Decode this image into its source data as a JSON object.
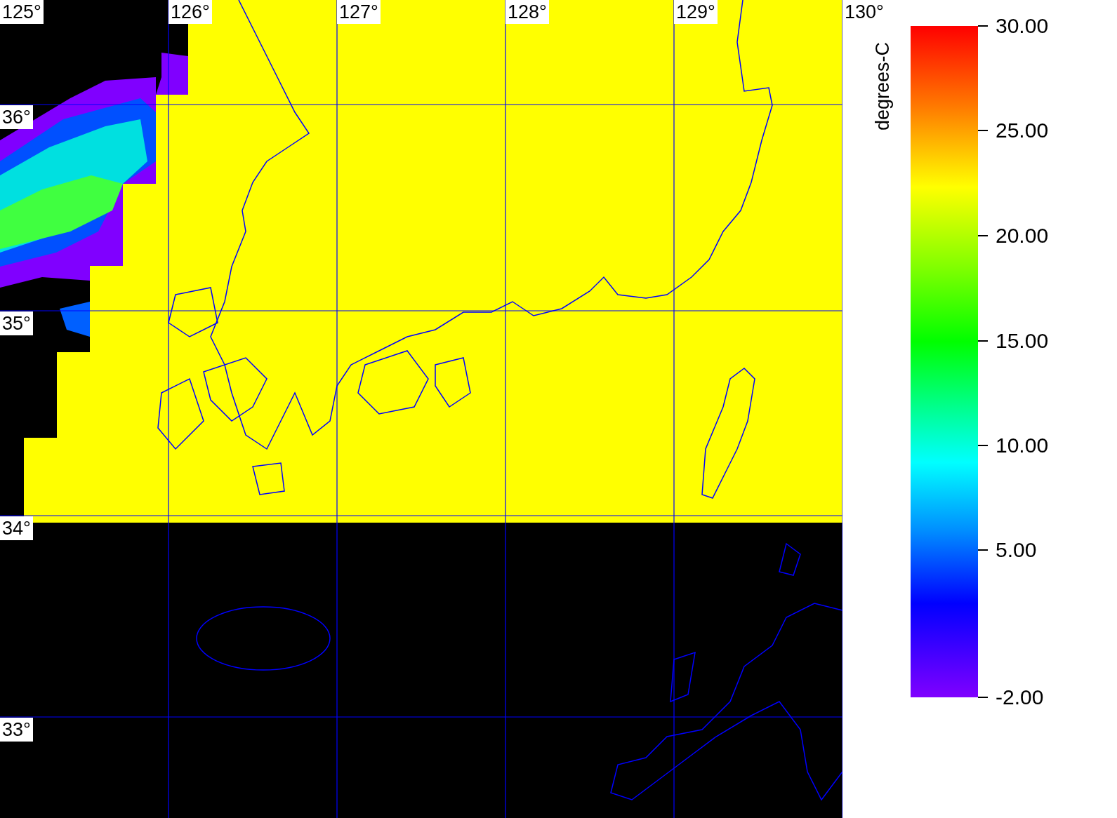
{
  "map": {
    "longitude_labels": [
      "125°",
      "126°",
      "127°",
      "128°",
      "129°",
      "130°"
    ],
    "latitude_labels": [
      "36°",
      "35°",
      "34°",
      "33°"
    ]
  },
  "colorbar": {
    "unit": "degrees-C",
    "ticks": [
      "30.00",
      "25.00",
      "20.00",
      "15.00",
      "10.00",
      "5.00",
      "-2.00"
    ]
  }
}
